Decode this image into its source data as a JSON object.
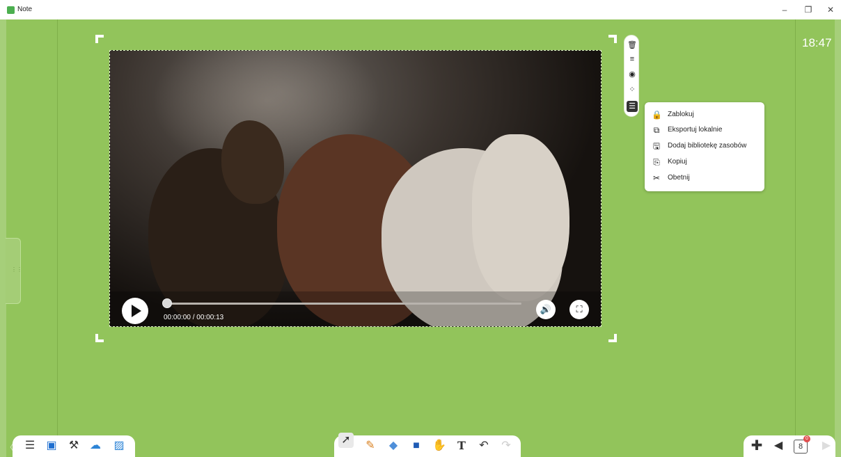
{
  "window": {
    "title": "Note",
    "controls": {
      "minimize": "–",
      "maximize": "❐",
      "close": "✕"
    }
  },
  "clock": "18:47",
  "video": {
    "time": "00:00:00 / 00:00:13",
    "progress": 0.0,
    "icons": [
      "play-icon",
      "volume-icon",
      "fullscreen-icon"
    ]
  },
  "object_toolbar": {
    "tools": [
      "trash-icon",
      "align-icon",
      "camera-icon",
      "effects-icon",
      "menu-icon"
    ]
  },
  "context_menu": {
    "items": [
      {
        "label": "Zablokuj",
        "icon": "lock-icon"
      },
      {
        "label": "Eksportuj lokalnie",
        "icon": "export-icon"
      },
      {
        "label": "Dodaj bibliotekę zasobów",
        "icon": "library-icon"
      },
      {
        "label": "Kopiuj",
        "icon": "copy-icon"
      },
      {
        "label": "Obetnij",
        "icon": "scissors-icon"
      }
    ]
  },
  "bottom_toolbar": {
    "left": [
      "menu-icon",
      "screen-icon",
      "tools-icon",
      "cloud-icon",
      "image-icon"
    ],
    "center": [
      "pointer-icon",
      "pen-icon",
      "eraser-icon",
      "shape-icon",
      "hand-icon",
      "text-icon",
      "undo-icon",
      "redo-icon"
    ],
    "right": [
      "add-page-icon",
      "prev-page-icon",
      "page-icon",
      "next-page-icon"
    ],
    "page_number": "8",
    "page_badge": "0"
  },
  "colors": {
    "canvas": "#92c45b",
    "accent": "#e05050"
  }
}
